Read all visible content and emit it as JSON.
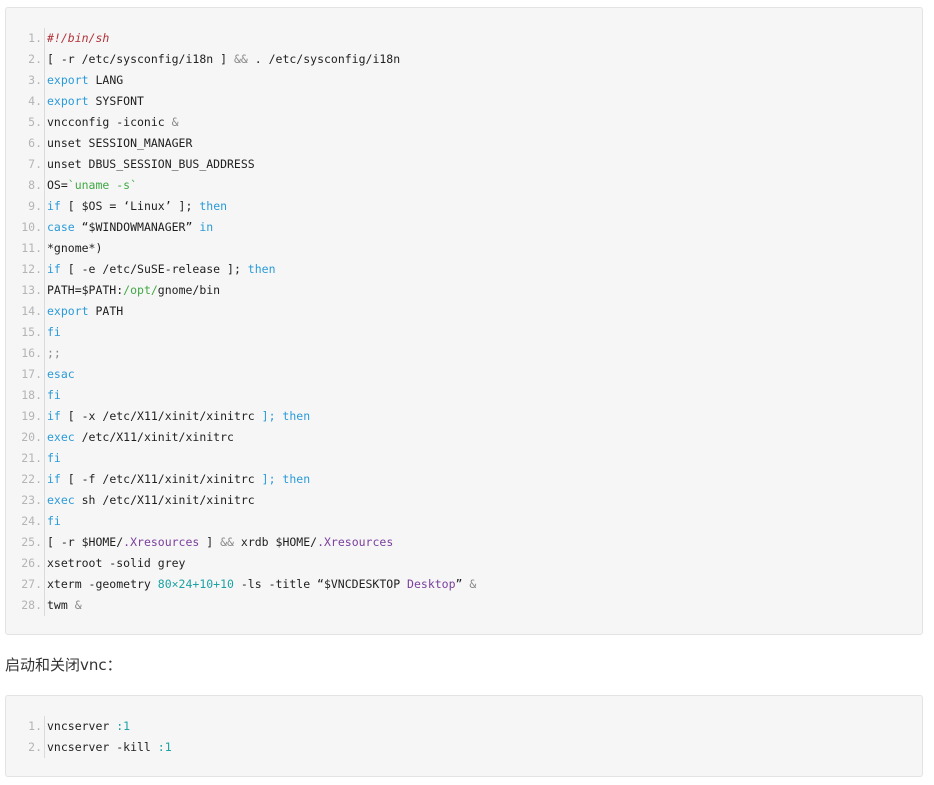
{
  "code_block_1": {
    "lines": [
      [
        {
          "t": "#!/bin/sh",
          "c": "cm"
        }
      ],
      [
        {
          "t": "[ -r ",
          "c": ""
        },
        {
          "t": "/etc/sysconfig/i18n",
          "c": ""
        },
        {
          "t": " ] ",
          "c": ""
        },
        {
          "t": "&&",
          "c": "op"
        },
        {
          "t": " . /etc/sysconfig/i18n",
          "c": ""
        }
      ],
      [
        {
          "t": "export",
          "c": "kw"
        },
        {
          "t": " LANG",
          "c": ""
        }
      ],
      [
        {
          "t": "export",
          "c": "kw"
        },
        {
          "t": " SYSFONT",
          "c": ""
        }
      ],
      [
        {
          "t": "vncconfig -iconic ",
          "c": ""
        },
        {
          "t": "&",
          "c": "op"
        }
      ],
      [
        {
          "t": "unset SESSION_MANAGER",
          "c": ""
        }
      ],
      [
        {
          "t": "unset DBUS_SESSION_BUS_ADDRESS",
          "c": ""
        }
      ],
      [
        {
          "t": "OS=",
          "c": ""
        },
        {
          "t": "`uname -s`",
          "c": "st"
        }
      ],
      [
        {
          "t": "if",
          "c": "kw"
        },
        {
          "t": " [ $OS = ‘Linux’ ]; ",
          "c": ""
        },
        {
          "t": "then",
          "c": "kw"
        }
      ],
      [
        {
          "t": "case",
          "c": "kw"
        },
        {
          "t": " “$WINDOWMANAGER” ",
          "c": ""
        },
        {
          "t": "in",
          "c": "kw"
        }
      ],
      [
        {
          "t": "*gnome*)",
          "c": ""
        }
      ],
      [
        {
          "t": "if",
          "c": "kw"
        },
        {
          "t": " [ -e /etc/SuSE-release ]; ",
          "c": ""
        },
        {
          "t": "then",
          "c": "kw"
        }
      ],
      [
        {
          "t": "PATH=$PATH:",
          "c": ""
        },
        {
          "t": "/opt/",
          "c": "st"
        },
        {
          "t": "gnome/bin",
          "c": ""
        }
      ],
      [
        {
          "t": "export",
          "c": "kw"
        },
        {
          "t": " PATH",
          "c": ""
        }
      ],
      [
        {
          "t": "fi",
          "c": "kw"
        }
      ],
      [
        {
          "t": ";;",
          "c": "op"
        }
      ],
      [
        {
          "t": "esac",
          "c": "kw"
        }
      ],
      [
        {
          "t": "fi",
          "c": "kw"
        }
      ],
      [
        {
          "t": "if",
          "c": "kw"
        },
        {
          "t": " [ -x /etc/X11/xinit/xinitrc ",
          "c": ""
        },
        {
          "t": "]; then",
          "c": "kw"
        }
      ],
      [
        {
          "t": "exec",
          "c": "kw"
        },
        {
          "t": " /etc/X11/xinit/xinitrc",
          "c": ""
        }
      ],
      [
        {
          "t": "fi",
          "c": "kw"
        }
      ],
      [
        {
          "t": "if",
          "c": "kw"
        },
        {
          "t": " [ -f /etc/X11/xinit/xinitrc ",
          "c": ""
        },
        {
          "t": "]; then",
          "c": "kw"
        }
      ],
      [
        {
          "t": "exec",
          "c": "kw"
        },
        {
          "t": " sh /etc/X11/xinit/xinitrc",
          "c": ""
        }
      ],
      [
        {
          "t": "fi",
          "c": "kw"
        }
      ],
      [
        {
          "t": "[ -r $HOME/",
          "c": ""
        },
        {
          "t": ".Xresources",
          "c": "vr"
        },
        {
          "t": " ] ",
          "c": ""
        },
        {
          "t": "&&",
          "c": "op"
        },
        {
          "t": " xrdb $HOME/",
          "c": ""
        },
        {
          "t": ".Xresources",
          "c": "vr"
        }
      ],
      [
        {
          "t": "xsetroot -solid grey",
          "c": ""
        }
      ],
      [
        {
          "t": "xterm -geometry ",
          "c": ""
        },
        {
          "t": "80×24+10+10",
          "c": "nm"
        },
        {
          "t": " -ls -title “$VNCDESKTOP ",
          "c": ""
        },
        {
          "t": "Desktop",
          "c": "vr"
        },
        {
          "t": "” ",
          "c": ""
        },
        {
          "t": "&",
          "c": "op"
        }
      ],
      [
        {
          "t": "twm ",
          "c": ""
        },
        {
          "t": "&",
          "c": "op"
        }
      ]
    ]
  },
  "between_text": "启动和关闭vnc：",
  "code_block_2": {
    "lines": [
      [
        {
          "t": "vncserver ",
          "c": ""
        },
        {
          "t": ":1",
          "c": "nm"
        }
      ],
      [
        {
          "t": "vncserver -kill ",
          "c": ""
        },
        {
          "t": ":1",
          "c": "nm"
        }
      ]
    ]
  }
}
